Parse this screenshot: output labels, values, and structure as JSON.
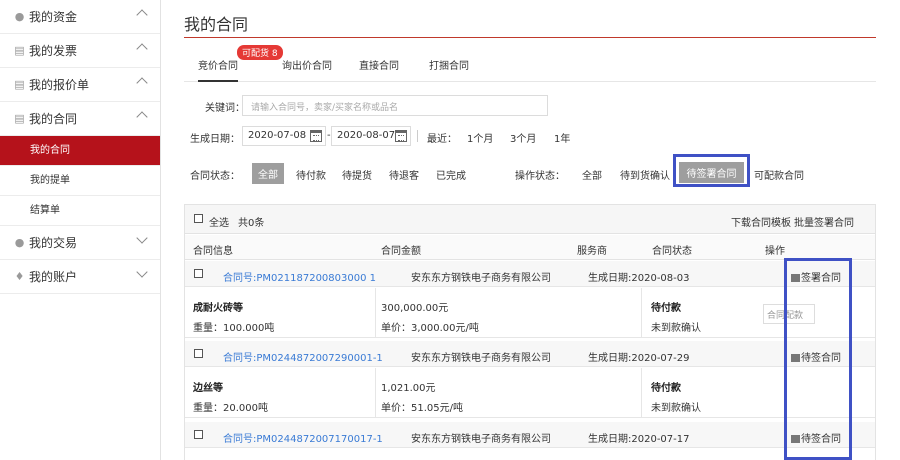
{
  "sidebar": {
    "groups": [
      {
        "label": "我的资金",
        "icon": "money-bag-icon"
      },
      {
        "label": "我的发票",
        "icon": "invoice-icon"
      },
      {
        "label": "我的报价单",
        "icon": "quote-icon"
      },
      {
        "label": "我的合同",
        "icon": "contract-icon"
      },
      {
        "label": "我的交易",
        "icon": "trade-icon"
      },
      {
        "label": "我的账户",
        "icon": "account-icon"
      }
    ],
    "contract_sub": [
      "我的合同",
      "我的提单",
      "结算单"
    ]
  },
  "page": {
    "title": "我的合同"
  },
  "tabs": [
    {
      "label": "竞价合同",
      "active": true
    },
    {
      "label": "询出价合同"
    },
    {
      "label": "直接合同"
    },
    {
      "label": "打捆合同"
    }
  ],
  "badge": "可配货 8",
  "filters": {
    "keyword_label": "关键词：",
    "keyword_placeholder": "请输入合同号，卖家/买家名称或品名",
    "date_label": "生成日期：",
    "date_from": "2020-07-08",
    "date_to": "2020-08-07",
    "recent_label": "最近：",
    "recent_options": [
      "1个月",
      "3个月",
      "1年"
    ],
    "status_label": "合同状态：",
    "status_options": [
      "全部",
      "待付款",
      "待提货",
      "待退客",
      "已完成"
    ],
    "op_label": "操作状态：",
    "op_options": [
      "全部",
      "待到货确认",
      "待签署合同",
      "可配款合同"
    ],
    "op_selected": "待签署合同"
  },
  "table": {
    "select_all": "全选",
    "count": "共0条",
    "links": [
      "下载合同模板",
      "批量签署合同"
    ],
    "headers": [
      "合同信息",
      "合同金额",
      "服务商",
      "合同状态",
      "操作"
    ],
    "contracts": [
      {
        "no": "合同号:PM021187200803000 1",
        "provider": "安东东方钢铁电子商务有限公司",
        "date": "生成日期:2020-08-03",
        "action": "签署合同",
        "product": "成耐火砖等",
        "weight": "重量：100.000吨",
        "amount": "300,000.00元",
        "unit_price": "单价：3,000.00元/吨",
        "status": "待付款",
        "sub_status": "未到款确认",
        "match_label": "合同配款"
      },
      {
        "no": "合同号:PM0244872007290001-1",
        "provider": "安东东方钢铁电子商务有限公司",
        "date": "生成日期:2020-07-29",
        "action": "待签合同",
        "product": "边丝等",
        "weight": "重量：20.000吨",
        "amount": "1,021.00元",
        "unit_price": "单价：51.05元/吨",
        "status": "待付款",
        "sub_status": "未到款确认"
      },
      {
        "no": "合同号:PM0244872007170017-1",
        "provider": "安东东方钢铁电子商务有限公司",
        "date": "生成日期:2020-07-17",
        "action": "待签合同"
      }
    ]
  }
}
